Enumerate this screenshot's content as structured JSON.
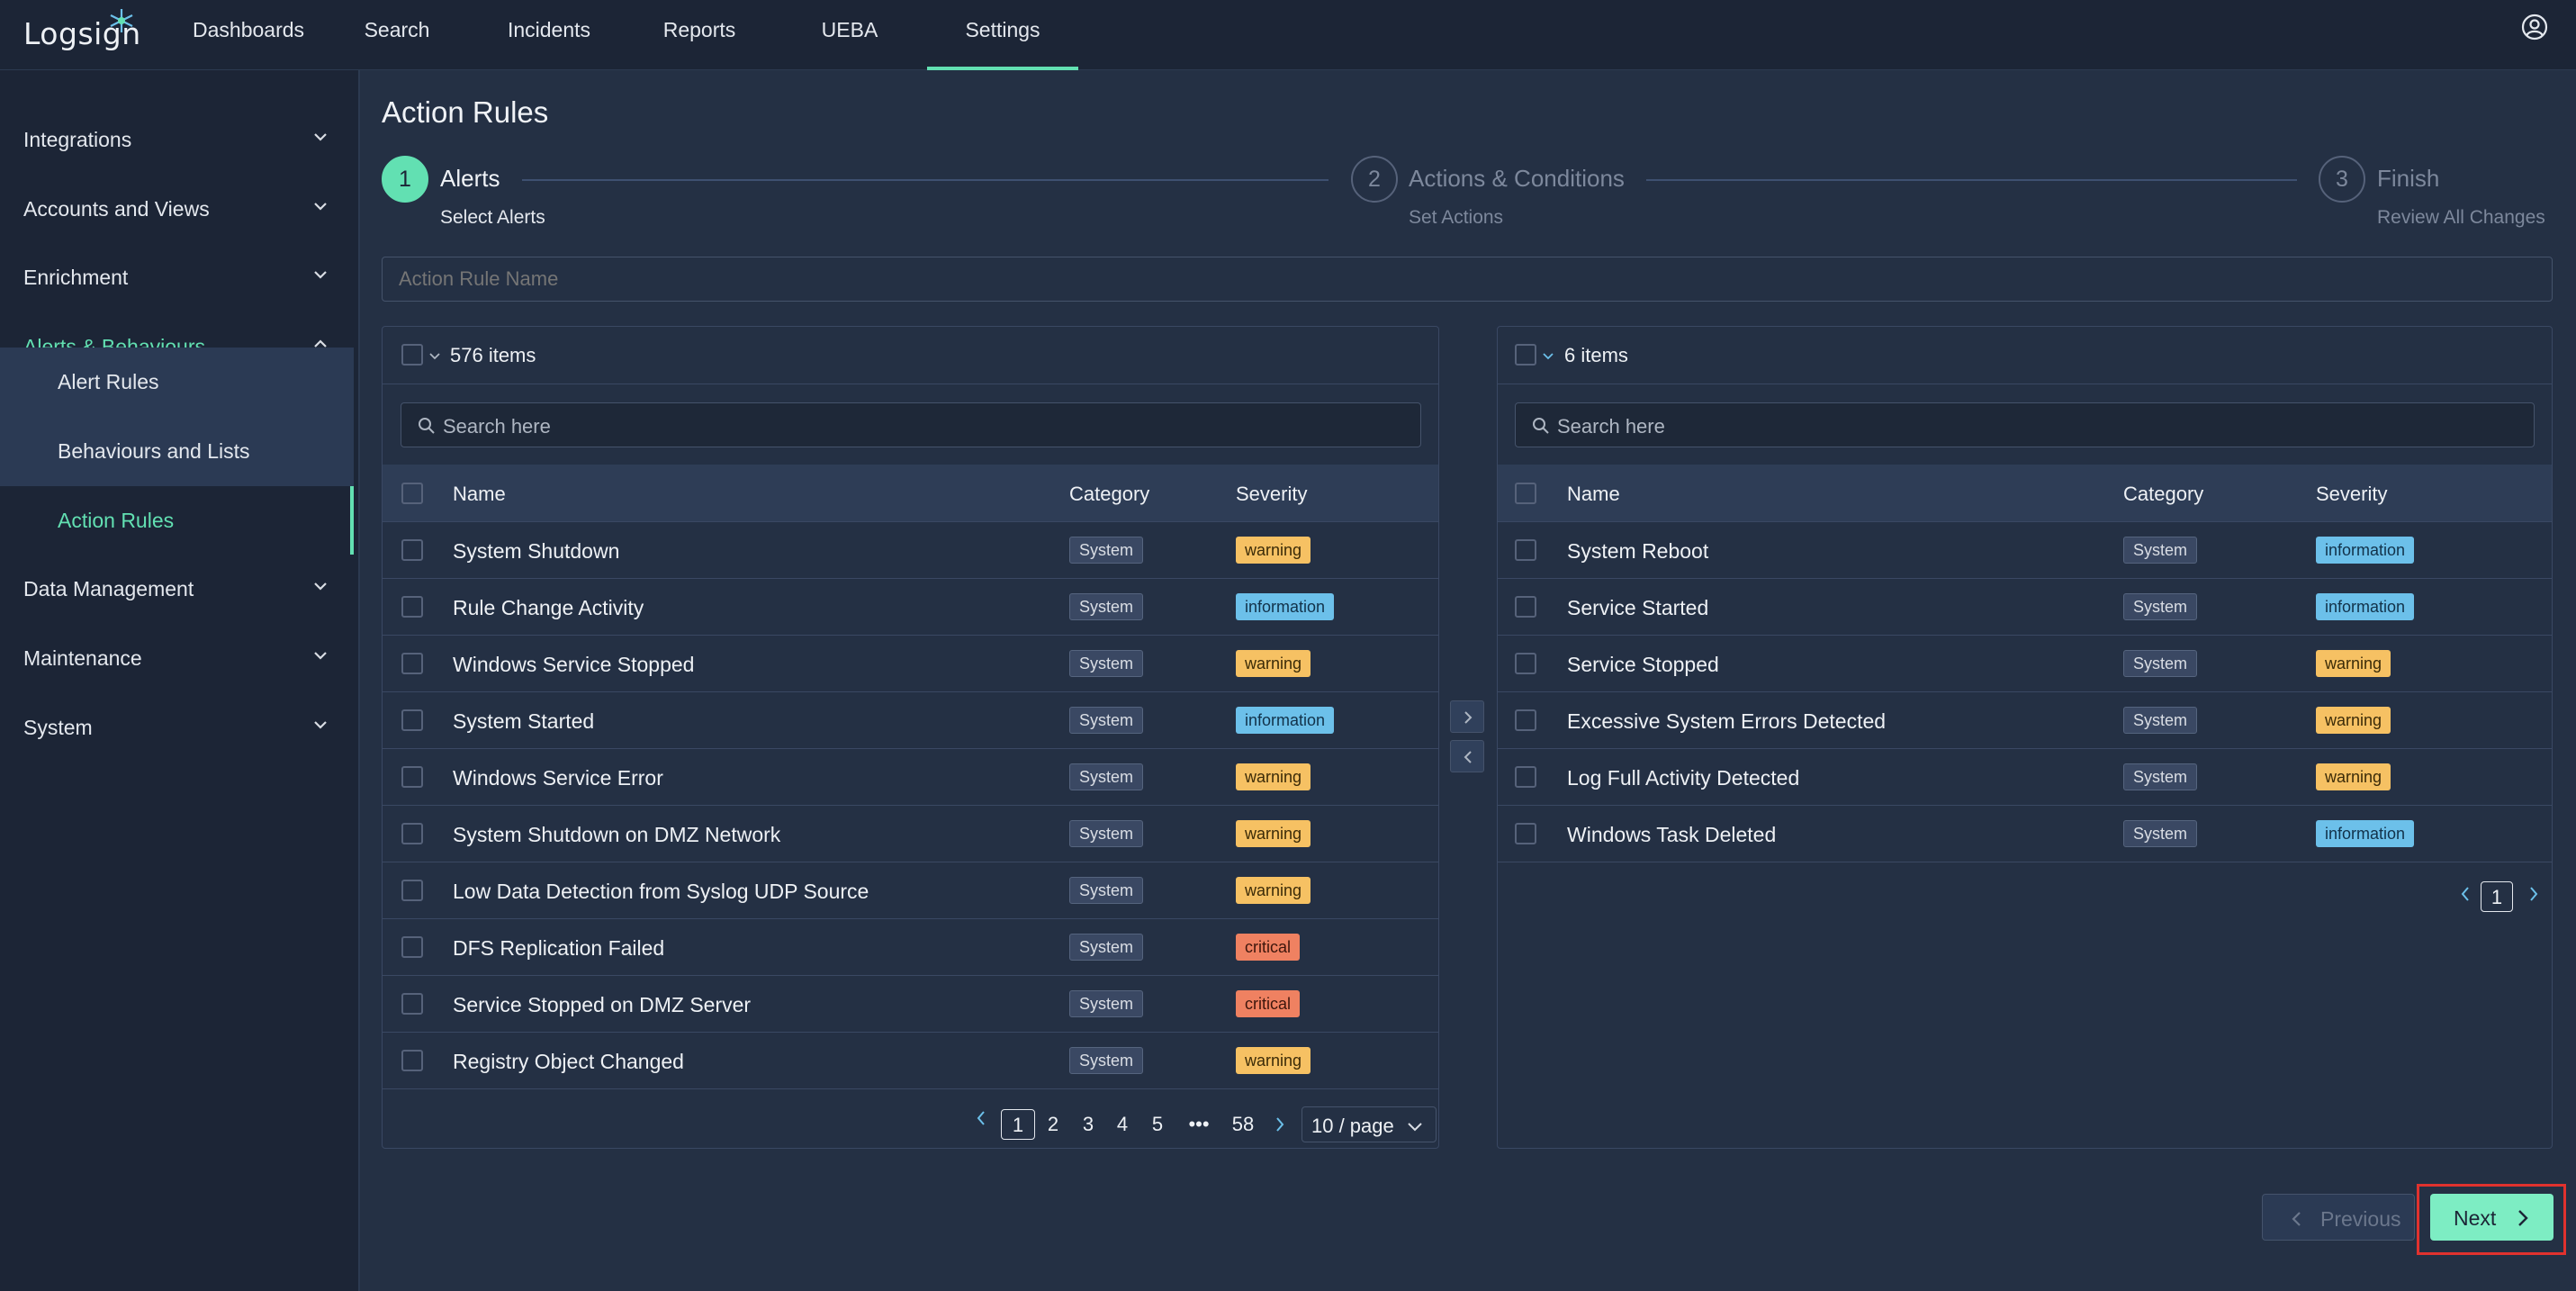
{
  "app": {
    "logo_text": "Logsign"
  },
  "nav": {
    "items": [
      "Dashboards",
      "Search",
      "Incidents",
      "Reports",
      "UEBA",
      "Settings"
    ],
    "active": "Settings"
  },
  "sidebar": {
    "items": [
      "Integrations",
      "Accounts and Views",
      "Enrichment",
      "Alerts & Behaviours",
      "Data Management",
      "Maintenance",
      "System"
    ],
    "sub_items": [
      "Alert Rules",
      "Behaviours and Lists",
      "Action Rules"
    ],
    "active_sub": "Action Rules"
  },
  "page": {
    "title": "Action Rules"
  },
  "steps": [
    {
      "num": "1",
      "title": "Alerts",
      "sub": "Select Alerts"
    },
    {
      "num": "2",
      "title": "Actions & Conditions",
      "sub": "Set Actions"
    },
    {
      "num": "3",
      "title": "Finish",
      "sub": "Review All Changes"
    }
  ],
  "rule_name": {
    "placeholder": "Action Rule Name"
  },
  "left_panel": {
    "count": "576 items",
    "search_placeholder": "Search here",
    "headers": {
      "name": "Name",
      "category": "Category",
      "severity": "Severity"
    },
    "rows": [
      {
        "name": "System Shutdown",
        "category": "System",
        "severity": "warning"
      },
      {
        "name": "Rule Change Activity",
        "category": "System",
        "severity": "information"
      },
      {
        "name": "Windows Service Stopped",
        "category": "System",
        "severity": "warning"
      },
      {
        "name": "System Started",
        "category": "System",
        "severity": "information"
      },
      {
        "name": "Windows Service Error",
        "category": "System",
        "severity": "warning"
      },
      {
        "name": "System Shutdown on DMZ Network",
        "category": "System",
        "severity": "warning"
      },
      {
        "name": "Low Data Detection from Syslog UDP Source",
        "category": "System",
        "severity": "warning"
      },
      {
        "name": "DFS Replication Failed",
        "category": "System",
        "severity": "critical"
      },
      {
        "name": "Service Stopped on DMZ Server",
        "category": "System",
        "severity": "critical"
      },
      {
        "name": "Registry Object Changed",
        "category": "System",
        "severity": "warning"
      }
    ],
    "pagination": {
      "pages": [
        "1",
        "2",
        "3",
        "4",
        "5",
        "•••",
        "58"
      ],
      "current": "1",
      "page_size": "10 / page"
    }
  },
  "right_panel": {
    "count": "6 items",
    "search_placeholder": "Search here",
    "headers": {
      "name": "Name",
      "category": "Category",
      "severity": "Severity"
    },
    "rows": [
      {
        "name": "System Reboot",
        "category": "System",
        "severity": "information"
      },
      {
        "name": "Service Started",
        "category": "System",
        "severity": "information"
      },
      {
        "name": "Service Stopped",
        "category": "System",
        "severity": "warning"
      },
      {
        "name": "Excessive System Errors Detected",
        "category": "System",
        "severity": "warning"
      },
      {
        "name": "Log Full Activity Detected",
        "category": "System",
        "severity": "warning"
      },
      {
        "name": "Windows Task Deleted",
        "category": "System",
        "severity": "information"
      }
    ],
    "pagination": {
      "current": "1"
    }
  },
  "footer": {
    "previous_label": "Previous",
    "next_label": "Next"
  },
  "colors": {
    "accent": "#62e0b2",
    "warning": "#f6c163",
    "information": "#6cc0ea",
    "critical": "#ef8161",
    "highlight": "#e0322e"
  }
}
